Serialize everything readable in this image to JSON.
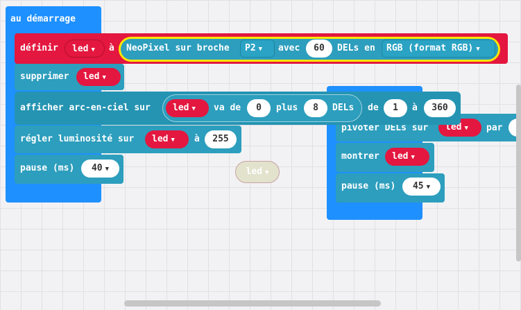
{
  "on_start": {
    "label": "au démarrage"
  },
  "define_block": {
    "label": "définir",
    "variable": "led",
    "to_label": "à",
    "neopixel_label": "NeoPixel sur broche",
    "pin": "P2",
    "with_label": "avec",
    "count": "60",
    "leds_label": "DELs en",
    "mode": "RGB (format RGB)"
  },
  "clear_block": {
    "label": "supprimer",
    "variable": "led"
  },
  "rainbow_block": {
    "label": "afficher arc-en-ciel sur",
    "variable": "led",
    "from_label": "va de",
    "start": "0",
    "plus_label": "plus",
    "length": "8",
    "leds_label": "DELs",
    "of_label": "de",
    "hue_start": "1",
    "to_label": "à",
    "hue_end": "360"
  },
  "brightness_block": {
    "label": "régler luminosité sur",
    "variable": "led",
    "to_label": "à",
    "value": "255"
  },
  "pause_block_1": {
    "label": "pause (ms)",
    "value": "40"
  },
  "floating_variable": {
    "label": "led"
  },
  "rotate_block": {
    "label": "pivoter DELs sur",
    "variable": "led",
    "by_label": "par"
  },
  "show_block": {
    "label": "montrer",
    "variable": "led"
  },
  "pause_block_2": {
    "label": "pause (ms)",
    "value": "45"
  },
  "colors": {
    "hat": "#1e90ff",
    "neopixel": "#2d9ebd",
    "variable": "#e3173f",
    "highlight": "#ffe600",
    "background": "#f2f2f4"
  }
}
